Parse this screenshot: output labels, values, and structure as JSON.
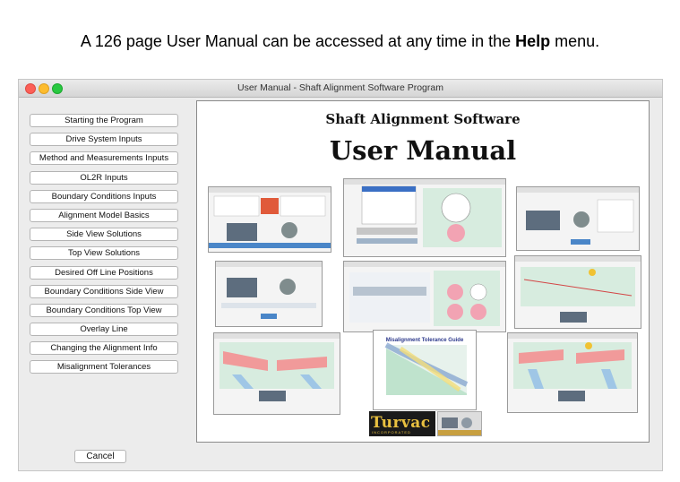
{
  "caption": {
    "prefix": "A 126 page User Manual can be accessed at any time in the ",
    "emphasis": "Help",
    "suffix": " menu."
  },
  "window": {
    "title": "User Manual - Shaft Alignment Software Program"
  },
  "nav": {
    "items": [
      "Starting the Program",
      "Drive System Inputs",
      "Method and Measurements Inputs",
      "OL2R Inputs",
      "Boundary Conditions Inputs",
      "Alignment Model Basics",
      "Side View Solutions",
      "Top View Solutions",
      "Desired Off Line Positions",
      "Boundary Conditions Side View",
      "Boundary Conditions Top View",
      "Overlay Line",
      "Changing the Alignment Info",
      "Misalignment Tolerances"
    ],
    "cancel_label": "Cancel"
  },
  "document": {
    "title": "Shaft Alignment Software",
    "subtitle": "User Manual",
    "logo_text": "Turvac",
    "logo_sub": "INCORPORATED",
    "tolerance_guide_title": "Misalignment Tolerance Guide"
  },
  "colors": {
    "accent_blue": "#2e6fd6",
    "chart_green": "#cfe8d6",
    "chart_red": "#f19a9a"
  }
}
